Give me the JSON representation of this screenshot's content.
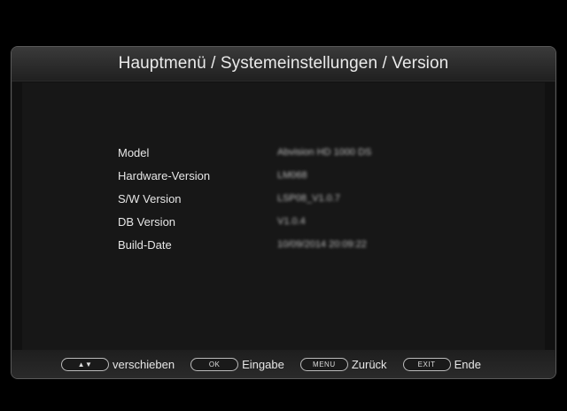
{
  "header": {
    "title": "Hauptmenü / Systemeinstellungen / Version"
  },
  "info": {
    "rows": [
      {
        "label": "Model",
        "value": "Abvision HD 1000 DS"
      },
      {
        "label": "Hardware-Version",
        "value": "LM068"
      },
      {
        "label": "S/W Version",
        "value": "LSP08_V1.0.7"
      },
      {
        "label": "DB Version",
        "value": "V1.0.4"
      },
      {
        "label": "Build-Date",
        "value": "10/09/2014 20:09:22"
      }
    ]
  },
  "footer": {
    "hints": [
      {
        "key": "▲▼",
        "key_icon": "up-down-arrow-icon",
        "label": "verschieben"
      },
      {
        "key": "OK",
        "key_icon": "ok-key-icon",
        "label": "Eingabe"
      },
      {
        "key": "MENU",
        "key_icon": "menu-key-icon",
        "label": "Zurück"
      },
      {
        "key": "EXIT",
        "key_icon": "exit-key-icon",
        "label": "Ende"
      }
    ]
  }
}
